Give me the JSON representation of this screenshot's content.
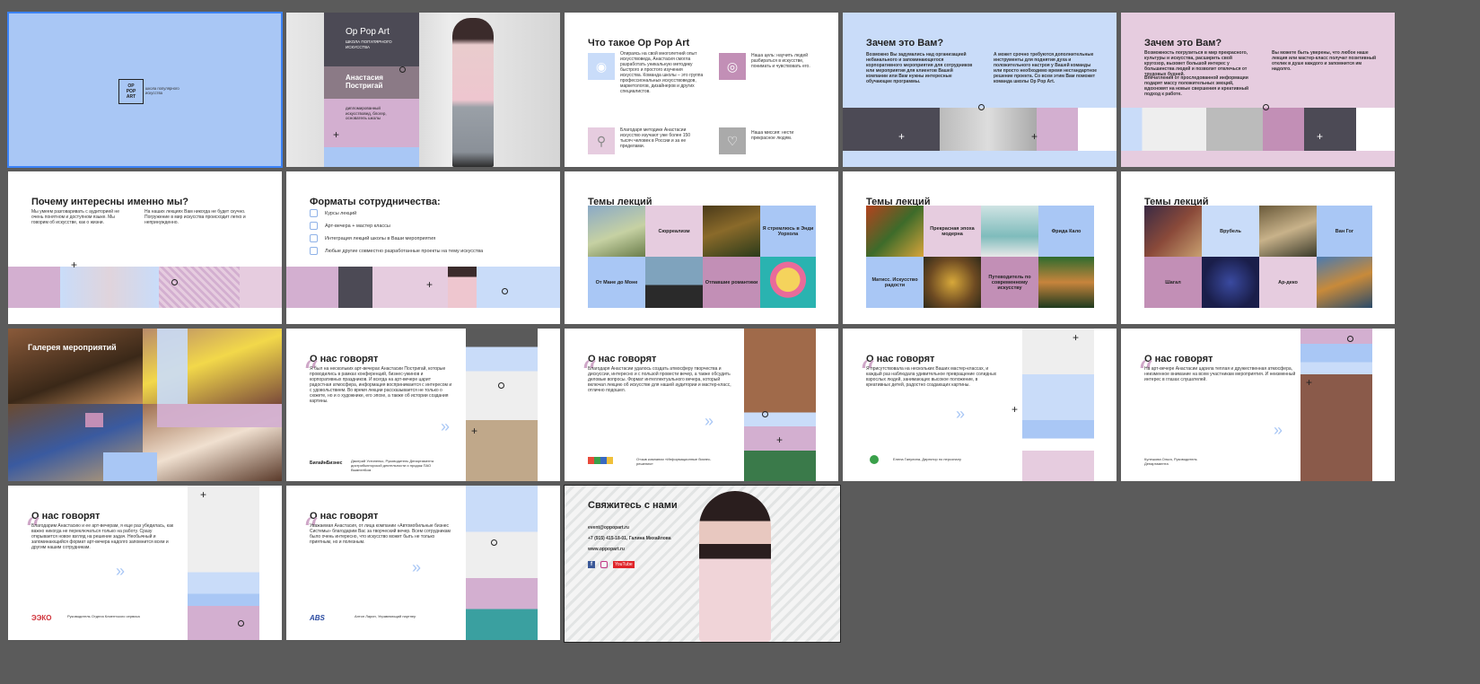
{
  "brand": {
    "logo_lines": [
      "OP",
      "POP",
      "ART"
    ],
    "logo_caption": "школа популярного искусства"
  },
  "slide2": {
    "title": "Op Pop Art",
    "subtitle": "ШКОЛА ПОПУЛЯРНОГО ИСКУССТВА",
    "name": "Анастасия Постригай",
    "role": "дипломированный искусствовед, блогер, основатель школы"
  },
  "slide3": {
    "title": "Что такое Op Pop Art",
    "items": [
      "Опираясь на свой многолетний опыт искусствоведа, Анастасия смогла разработать уникальную методику быстрого и простого изучения искусства. Команда школы – это группа профессиональных искусствоведов, маркетологов, дизайнеров и других специалистов.",
      "Наша цель: научить людей разбираться в искусстве, понимать и чувствовать его.",
      "Благодаря методике Анастасии искусство изучают уже более 150 тысяч человек в России и за ее пределами.",
      "Наша миссия: нести прекрасное людям."
    ]
  },
  "slide4": {
    "title": "Зачем это Вам?",
    "col1": "Возможно Вы задумались над организацией небанального и запоминающегося корпоративного мероприятия для сотрудников или мероприятия для клиентов Вашей компании или Вам нужны интересные обучающие программы.",
    "col2": "А может срочно требуются дополнительные инструменты для поднятия духа и положительного настроя у Вашей команды или просто необходимо время нестандартное решение проекта. Со всем этим Вам поможет команда школы Op Pop Art."
  },
  "slide5": {
    "title": "Зачем это Вам?",
    "col1": "Возможность погрузиться в мир прекрасного, культуры и искусства, расширить свой кругозор, вызовет большой интерес у большинства людей и позволит отвлечься от трудовых будней.",
    "col1b": "Впечатления от проследованной информации подарят массу положительных эмоций, вдохновят на новые свершения и креативный подход к работе.",
    "col2": "Вы можете быть уверены, что любое наше лекция или мастер-класс получат позитивный отклик в душе каждого и запомнится им надолго."
  },
  "slide6": {
    "title": "Почему интересны именно мы?",
    "col1": "Мы умеем разговаривать с аудиторией не очень понятном и доступном языке. Мы говорим об искусстве, как о жизни.",
    "col2": "На наших лекциях Вам никогда не будет скучно. Погружение в мир искусства происходит легко и непринужденно."
  },
  "slide7": {
    "title": "Форматы  сотрудничества:",
    "items": [
      "Курсы лекций",
      "Арт-вечера + мастер классы",
      "Интеграция лекций школы в Ваши мероприятия",
      "Любые другие совместно разработанные проекты на тему искусства"
    ]
  },
  "slide8": {
    "title": "Темы лекций",
    "tiles": [
      "Сюрреализм",
      "Я стремлюсь в Энди Уорхола",
      "От Мане до Моне",
      "Отпавшие романтики"
    ]
  },
  "slide9": {
    "title": "Темы лекций",
    "tiles": [
      "Прекрасная эпоха модерна",
      "Фрида Кало",
      "Матисс. Искусство радости",
      "Путеводитель по современному искусству"
    ]
  },
  "slide10": {
    "title": "Темы лекций",
    "tiles": [
      "Врубель",
      "Ван Гог",
      "Шагал",
      "Ар-деко"
    ]
  },
  "slide11": {
    "title": "Галерея мероприятий"
  },
  "reviews_title": "О нас говорят",
  "slide12": {
    "text": "Я был на нескольких арт-вечерах Анастасии Постригай, которые проводились в рамках конференций, бизнес-ужинов и корпоративных праздников. И всегда на арт-вечере царит радостная атмосфера, информация воспринимается с интересом и с удовольствием. Во время лекции рассказывается не только о сюжете, но и о художнике, его эпохе, а также об истории создания картины.",
    "company": "БилайнБизнес",
    "author": "Дмитрий Устиненко, Руководитель Департамента дистрибьюторской деятельности и продаж ПАО ВымпелКом"
  },
  "slide13": {
    "text": "Благодаря Анастасии удалось создать атмосферу творчества и дискуссии, интересно и с пользой провести вечер, а также обсудить деловые вопросы. Формат интеллектуального вечера, который включал лекцию об искусстве для нашей аудитории и мастер-класс, отлично подошел.",
    "author": "Отзыв компании «Информационные бизнес-решения»"
  },
  "slide14": {
    "text": "Я присутствовала на нескольких Ваших мастер-классах, и каждый раз наблюдала удивительное превращение солидных взрослых людей, занимающих высокое положение, в креативных детей, радостно создающих картины.",
    "author": "Елена Ганулина, Директор по персоналу"
  },
  "slide15": {
    "text": "На арт-вечере Анастасии царила теплая и дружественная атмосфера, неизменное внимание на всем участникам мероприятия. И неизменный интерес в глазах слушателей.",
    "author": "Кулешова Ольга, Руководитель Департамента"
  },
  "slide16": {
    "text": "Благодарим Анастасию и ее арт-вечерам, я еще раз убедилась, как важно никогда не переключаться только на работу. Сразу открывается новое взгляд на решение задач. Необычный и запоминающийся формат арт-вечера надолго запомнится всем и другим нашим сотрудникам.",
    "company": "ЭЭКО",
    "author": "Руководитель Отдела Клиентского сервиса"
  },
  "slide17": {
    "text": "Уважаемая Анастасия, от лица компании «Автомобильные бизнес Системы» благодарим Вас за творческий вечер. Всем сотрудникам было очень интересно, что искусство может быть не только приятным, но и полезным.",
    "company": "ABS",
    "author": "Антон Ларин, Управляющий партнер"
  },
  "slide18": {
    "title": "Свяжитесь с нами",
    "email": "event@oppopart.ru",
    "phone": "+7 (915) 415-18-01, Галина Михайлова",
    "site": "www.oppopart.ru",
    "youtube": "YouTube"
  },
  "colors": {
    "blue": "#c9dcf9",
    "blue_strong": "#a9c7f5",
    "pink": "#d3afd0",
    "pink_light": "#e6ccdf",
    "dark": "#4c4a55",
    "mauve": "#8b7a86"
  }
}
